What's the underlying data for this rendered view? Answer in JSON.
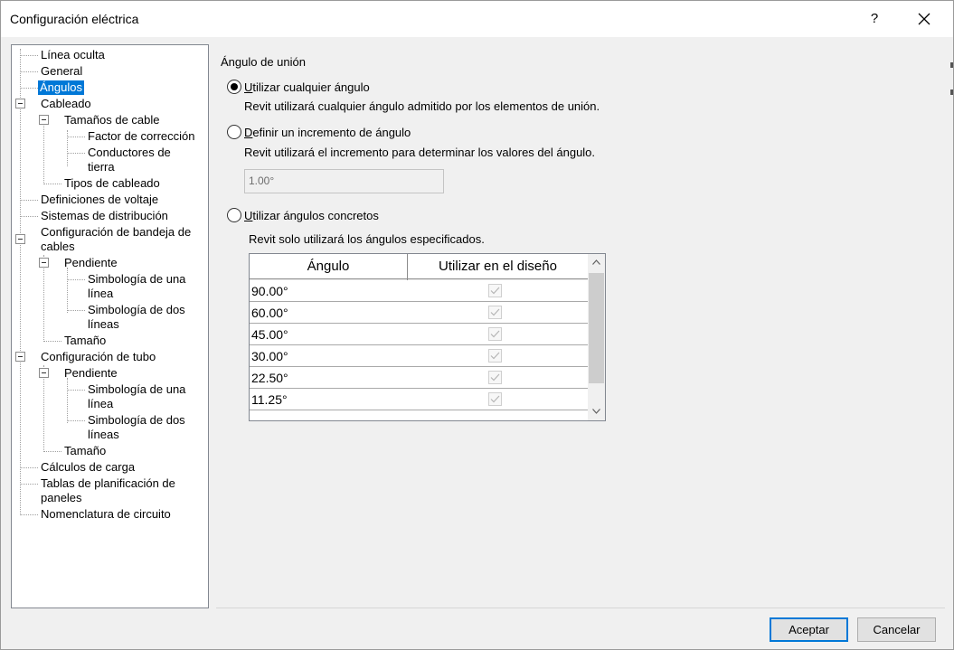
{
  "window": {
    "title": "Configuración eléctrica",
    "help_label": "?"
  },
  "tree": {
    "items": [
      {
        "label": "Línea oculta"
      },
      {
        "label": "General"
      },
      {
        "label": "Ángulos",
        "selected": true
      },
      {
        "label": "Cableado"
      },
      {
        "label": "Tamaños de cable"
      },
      {
        "label": "Factor de corrección"
      },
      {
        "label": "Conductores de"
      },
      {
        "label": "tierra"
      },
      {
        "label": "Tipos de cableado"
      },
      {
        "label": "Definiciones de voltaje"
      },
      {
        "label": "Sistemas de distribución"
      },
      {
        "label": "Configuración de bandeja de"
      },
      {
        "label": "cables"
      },
      {
        "label": "Pendiente"
      },
      {
        "label": "Simbología de una"
      },
      {
        "label": "línea"
      },
      {
        "label": "Simbología de dos"
      },
      {
        "label": "líneas"
      },
      {
        "label": "Tamaño"
      },
      {
        "label": "Configuración de tubo"
      },
      {
        "label": "Pendiente"
      },
      {
        "label": "Simbología de una"
      },
      {
        "label": "línea"
      },
      {
        "label": "Simbología de dos"
      },
      {
        "label": "líneas"
      },
      {
        "label": "Tamaño"
      },
      {
        "label": "Cálculos de carga"
      },
      {
        "label": "Tablas de planificación de"
      },
      {
        "label": "paneles"
      },
      {
        "label": "Nomenclatura de circuito"
      }
    ]
  },
  "panel": {
    "section_title": "Ángulo de unión",
    "options": [
      {
        "accel": "U",
        "label_rest": "tilizar cualquier ángulo",
        "checked": true,
        "description": "Revit utilizará cualquier ángulo admitido por los elementos de unión."
      },
      {
        "accel": "D",
        "label_rest": "efinir un incremento de ángulo",
        "checked": false,
        "description": "Revit utilizará el incremento para determinar los valores del ángulo."
      },
      {
        "accel": "U",
        "label_rest": "tilizar ángulos concretos",
        "checked": false,
        "description": "Revit solo utilizará los ángulos especificados."
      }
    ],
    "increment_value": "1.00°",
    "table": {
      "headers": [
        "Ángulo",
        "Utilizar en el diseño"
      ],
      "rows": [
        {
          "angle": "90.00°",
          "use": true
        },
        {
          "angle": "60.00°",
          "use": true
        },
        {
          "angle": "45.00°",
          "use": true
        },
        {
          "angle": "30.00°",
          "use": true
        },
        {
          "angle": "22.50°",
          "use": true
        },
        {
          "angle": "11.25°",
          "use": true
        }
      ]
    }
  },
  "buttons": {
    "ok": "Aceptar",
    "cancel": "Cancelar"
  },
  "icons": {
    "close": "close-icon",
    "expander": "collapse-minus-icon",
    "check": "checkmark-icon",
    "scroll_up": "chevron-up-icon",
    "scroll_down": "chevron-down-icon"
  },
  "colors": {
    "selection": "#0078d7",
    "primary_border": "#0078d7"
  }
}
